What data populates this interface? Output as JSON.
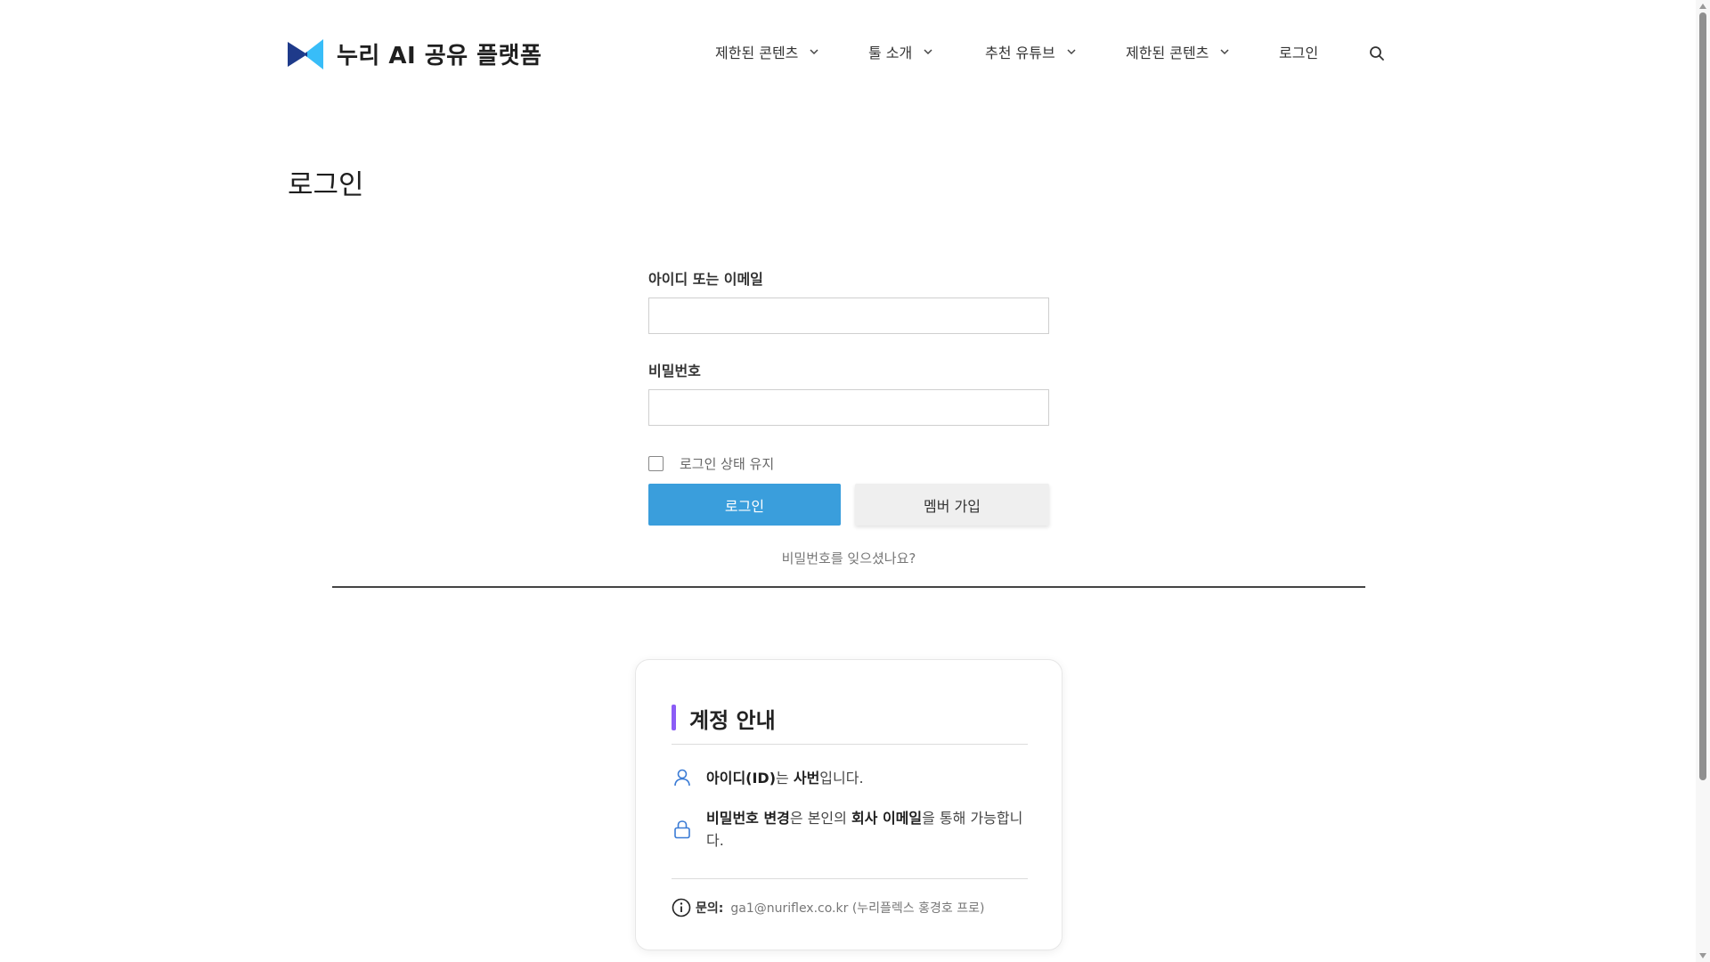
{
  "header": {
    "site_name": "누리 AI 공유 플랫폼",
    "logo_icon": "bowtie-logo-icon",
    "brand_colors": {
      "left": "#1e3a8a",
      "right": "#38bdf8"
    },
    "nav": [
      {
        "label": "제한된 콘텐츠",
        "has_dropdown": true
      },
      {
        "label": "툴 소개",
        "has_dropdown": true
      },
      {
        "label": "추천 유튜브",
        "has_dropdown": true
      },
      {
        "label": "제한된 콘텐츠",
        "has_dropdown": true
      },
      {
        "label": "로그인",
        "has_dropdown": false
      }
    ],
    "search_icon": "search-icon"
  },
  "page": {
    "title": "로그인"
  },
  "form": {
    "username_label": "아이디 또는 이메일",
    "username_value": "",
    "password_label": "비밀번호",
    "password_value": "",
    "remember_label": "로그인 상태 유지",
    "remember_checked": false,
    "login_button": "로그인",
    "join_button": "멤버 가입",
    "forgot_link": "비밀번호를 잊으셨나요?"
  },
  "info_card": {
    "title": "계정 안내",
    "accent_color": "#8b5cf6",
    "row1": {
      "icon": "user-icon",
      "bold1": "아이디(ID)",
      "text1": "는 ",
      "bold2": "사번",
      "text2": "입니다."
    },
    "row2": {
      "icon": "lock-icon",
      "bold1": "비밀번호 변경",
      "text1": "은 본인의 ",
      "bold2": "회사 이메일",
      "text2": "을 통해 가능합니다."
    },
    "contact": {
      "icon": "info-icon",
      "label": "문의:",
      "value": "ga1@nuriflex.co.kr (누리플렉스 홍경호 프로)"
    }
  },
  "colors": {
    "login_button": "#3a9edc",
    "join_button": "#efefef"
  }
}
